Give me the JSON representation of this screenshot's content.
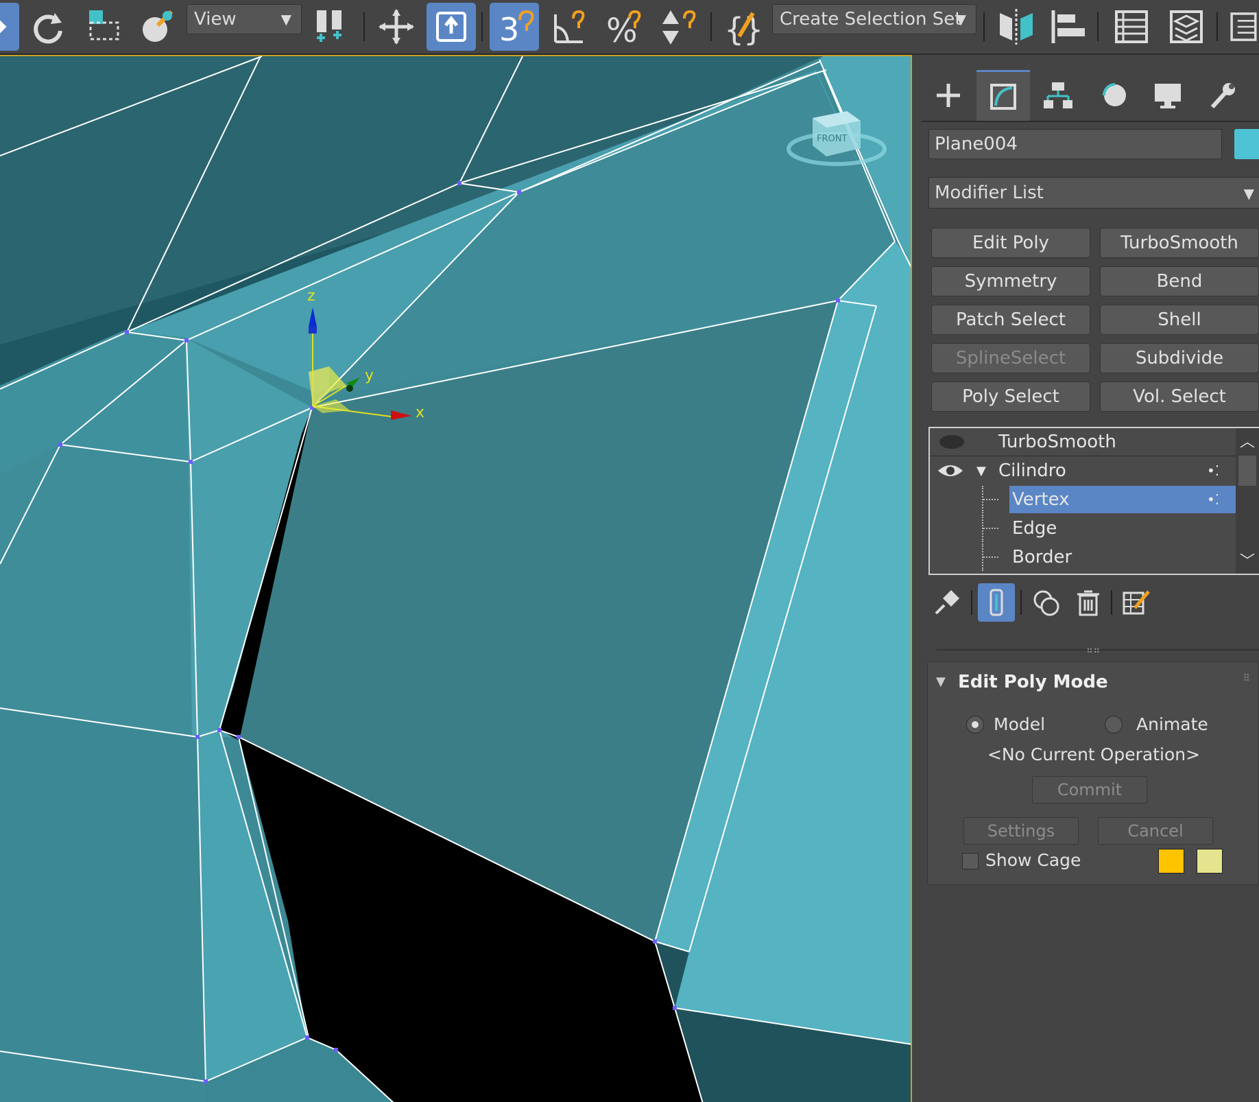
{
  "toolbar": {
    "view_dropdown": "View",
    "selection_set_dropdown": "Create Selection Set",
    "snap_3d_label": "3"
  },
  "viewport": {
    "viewcube_label": "FRONT",
    "gizmo": {
      "z": "z",
      "y": "y",
      "x": "x"
    }
  },
  "panel": {
    "tabs": [
      "create-tab",
      "modify-tab",
      "hierarchy-tab",
      "motion-tab",
      "display-tab",
      "utilities-tab"
    ],
    "object_name": "Plane004",
    "object_color": "#4fc3d6",
    "modifier_list": "Modifier List",
    "modifier_buttons": [
      "Edit Poly",
      "TurboSmooth",
      "Symmetry",
      "Bend",
      "Patch Select",
      "Shell",
      "SplineSelect",
      "Subdivide",
      "Poly Select",
      "Vol. Select"
    ],
    "stack": {
      "items": [
        "TurboSmooth",
        "Cilindro",
        "Vertex",
        "Edge",
        "Border"
      ],
      "selected": "Vertex"
    },
    "edit_poly_mode": {
      "title": "Edit Poly Mode",
      "model_label": "Model",
      "animate_label": "Animate",
      "operation": "<No Current Operation>",
      "commit": "Commit",
      "settings": "Settings",
      "cancel": "Cancel",
      "show_cage": "Show Cage",
      "cage_color_1": "#ffc400",
      "cage_color_2": "#e4e48e"
    }
  }
}
